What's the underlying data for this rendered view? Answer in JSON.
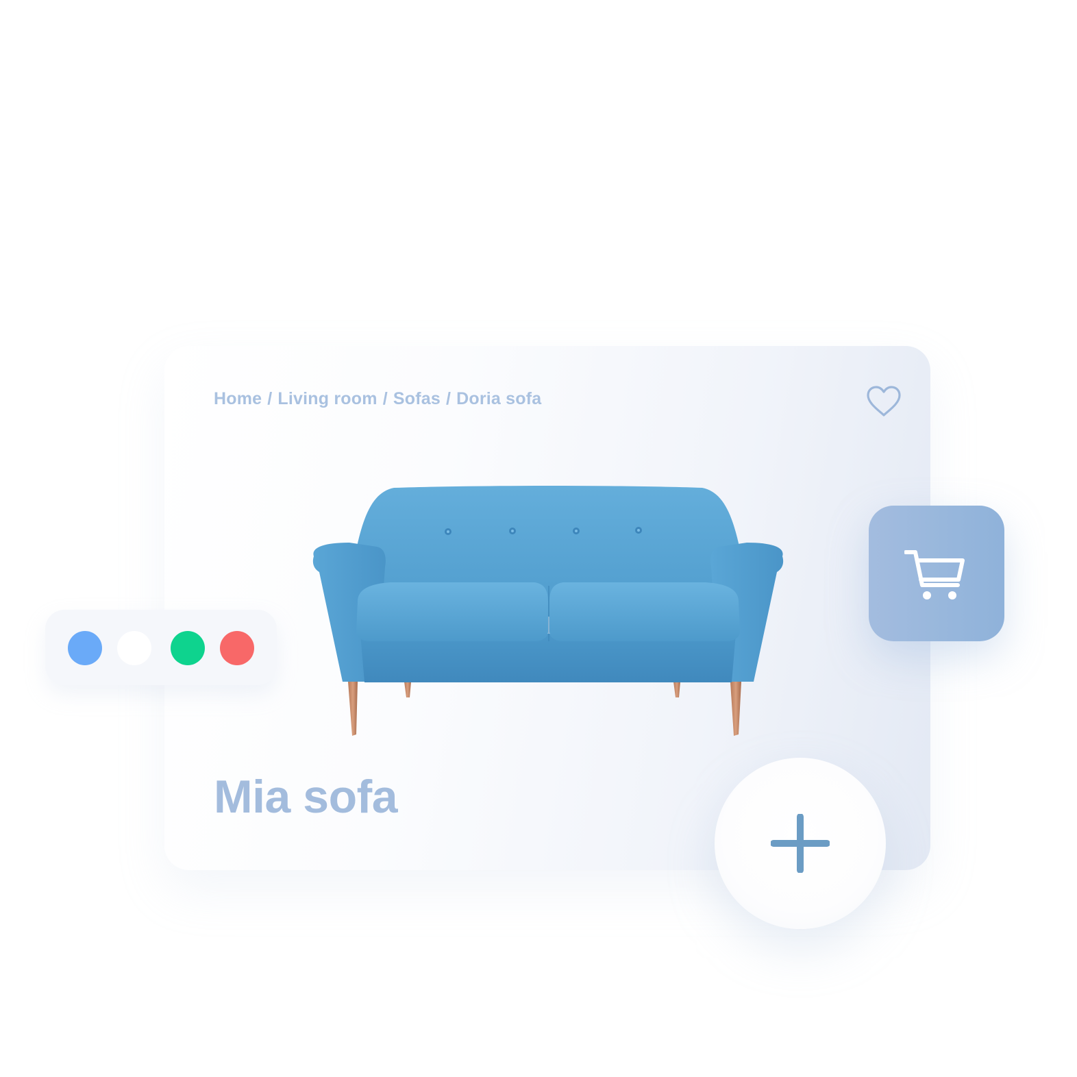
{
  "breadcrumb": {
    "items": [
      "Home",
      "Living room",
      "Sofas",
      "Doria sofa"
    ],
    "separator": "/"
  },
  "product": {
    "title": "Mia sofa",
    "image": "blue-tufted-sofa-photo"
  },
  "color_options": [
    {
      "name": "blue",
      "color": "#6aaaf8"
    },
    {
      "name": "white",
      "color": "#ffffff"
    },
    {
      "name": "green",
      "color": "#0ed38e"
    },
    {
      "name": "red",
      "color": "#f86868"
    }
  ],
  "icons": {
    "favorite": "heart-icon",
    "cart": "cart-icon",
    "add": "plus-icon"
  },
  "colors": {
    "accent": "#a3bcdd",
    "cart_button": "#98b7dc",
    "plus_icon": "#6b9cc4"
  }
}
